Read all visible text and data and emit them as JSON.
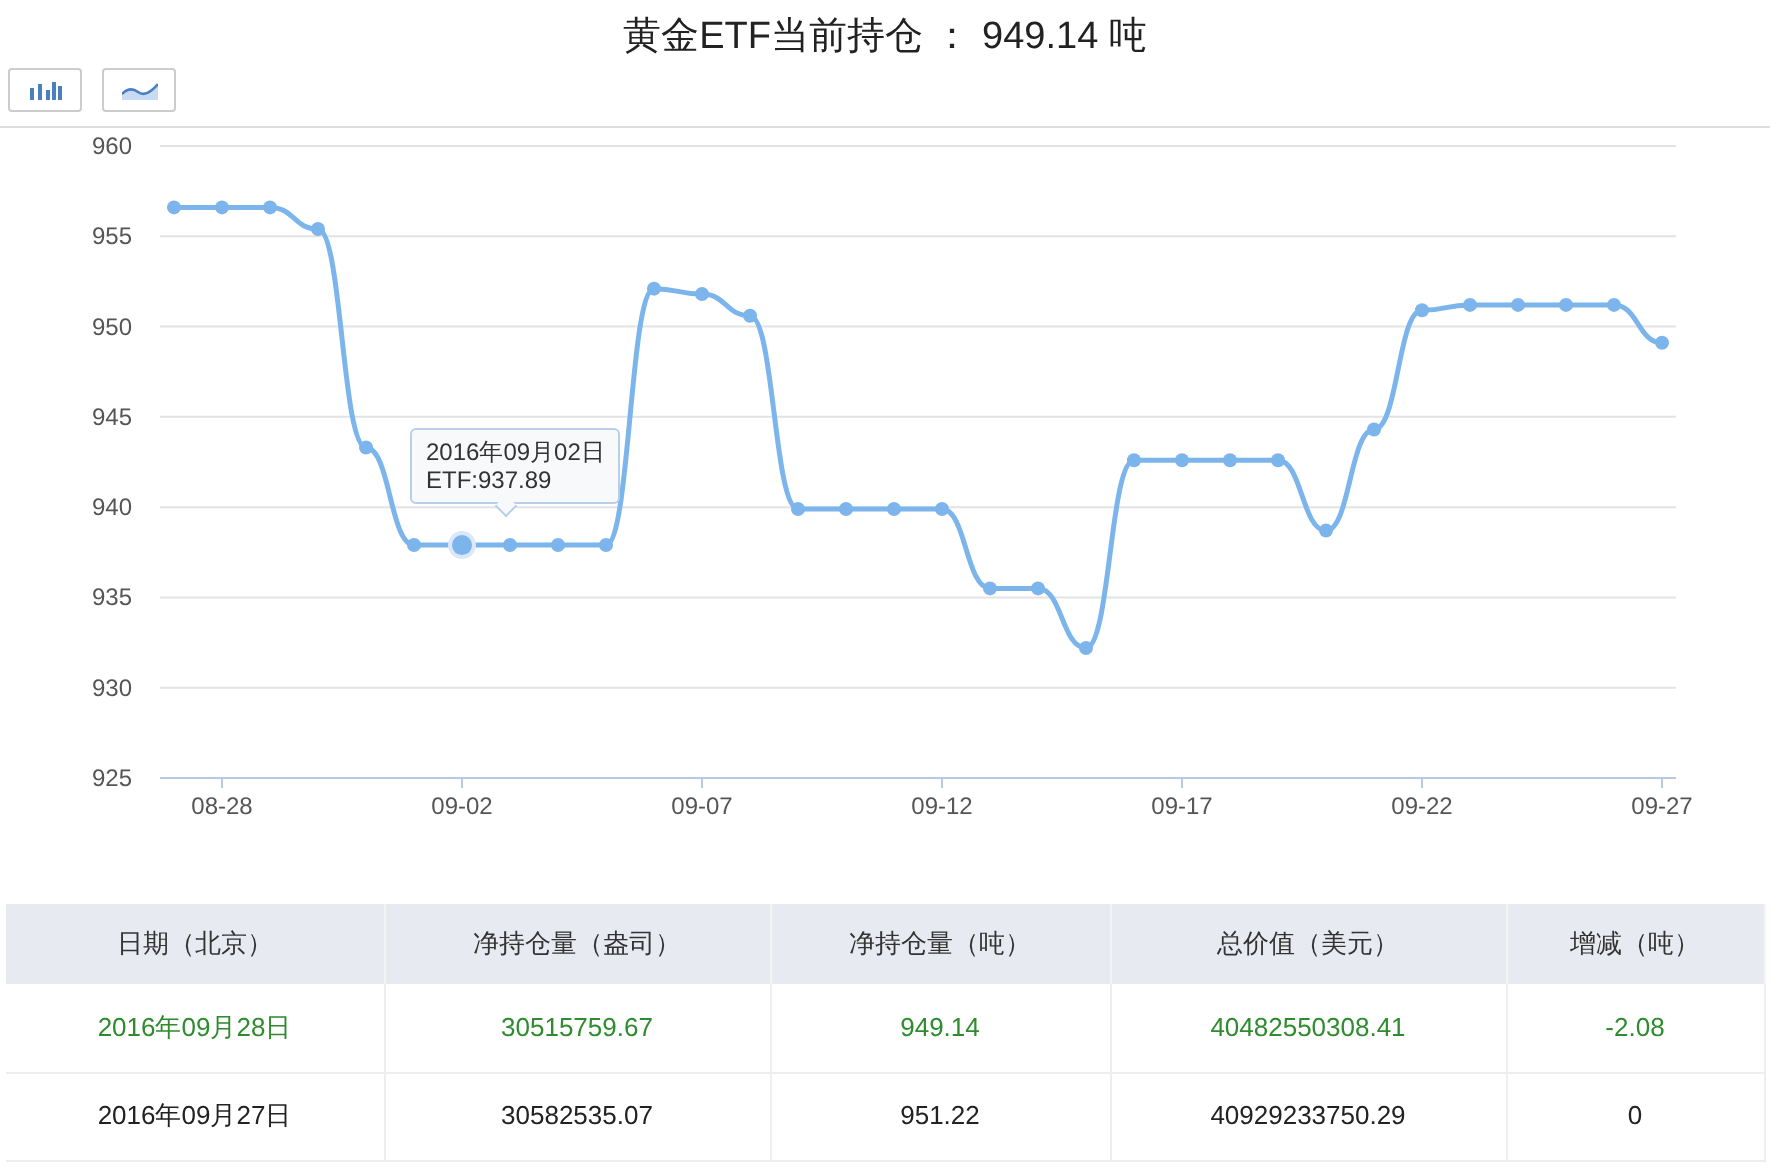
{
  "title": "黄金ETF当前持仓 ： 949.14 吨",
  "toolbar": [
    {
      "kind": "bar",
      "selected": false
    },
    {
      "kind": "line",
      "selected": false
    }
  ],
  "chart_data": {
    "type": "line",
    "grid": true,
    "categories": [
      null,
      "08-28",
      null,
      null,
      null,
      null,
      "09-02",
      null,
      null,
      null,
      null,
      "09-07",
      null,
      null,
      null,
      null,
      "09-12",
      null,
      null,
      null,
      null,
      "09-17",
      null,
      null,
      null,
      null,
      "09-22",
      null,
      null,
      null,
      null,
      "09-27"
    ],
    "series": [
      {
        "color": "#7cb5ec",
        "marker": true,
        "values": [
          956.6,
          956.6,
          956.6,
          955.4,
          943.3,
          937.9,
          937.9,
          937.9,
          937.9,
          937.9,
          952.1,
          951.8,
          950.6,
          939.9,
          939.9,
          939.9,
          939.9,
          935.5,
          935.5,
          932.2,
          942.6,
          942.6,
          942.6,
          942.6,
          938.7,
          944.3,
          950.9,
          951.2,
          951.2,
          951.2,
          951.2,
          949.1
        ]
      }
    ],
    "ylim": [
      925,
      960
    ],
    "yticks": [
      925,
      930,
      935,
      940,
      945,
      950,
      955,
      960
    ],
    "annotations": [
      {
        "x": "09-02",
        "y": 937.9,
        "text": "2016年09月02日\nETF:937.89"
      }
    ]
  },
  "table": {
    "columns": [
      "日期（北京）",
      "净持仓量（盎司）",
      "净持仓量（吨）",
      "总价值（美元）",
      "增减（吨）"
    ],
    "rows": [
      {
        "highlighted": true,
        "cells": [
          "2016年09月28日",
          "30515759.67",
          "949.14",
          "40482550308.41",
          "-2.08"
        ]
      },
      {
        "highlighted": false,
        "cells": [
          "2016年09月27日",
          "30582535.07",
          "951.22",
          "40929233750.29",
          "0"
        ]
      }
    ]
  }
}
